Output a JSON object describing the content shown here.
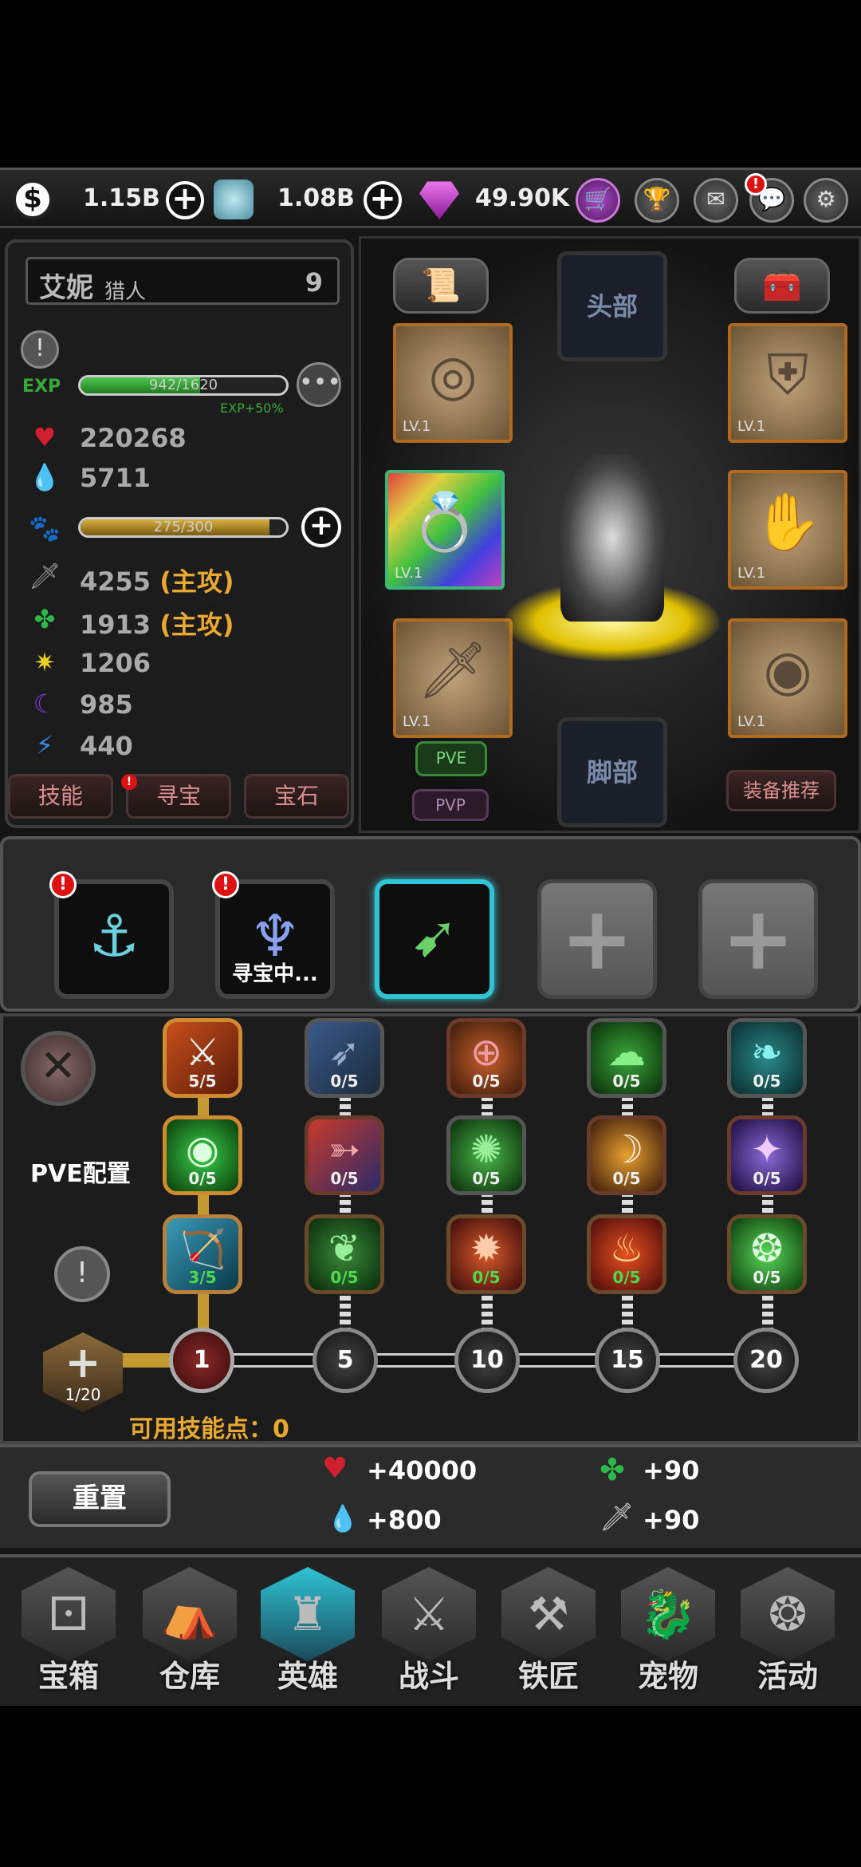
{
  "currency": {
    "gold": "1.15B",
    "crystal": "1.08B",
    "gem": "49.90K"
  },
  "topbar_icons": [
    "dollar-icon",
    "crystal-icon",
    "gem-icon",
    "cart-icon",
    "trophy-icon",
    "mail-icon",
    "chat-icon",
    "gear-icon"
  ],
  "hero": {
    "name": "艾妮",
    "class": "猎人",
    "level": "9",
    "exp_label": "EXP",
    "exp_text": "942/1620",
    "exp_fraction": 0.58,
    "exp_bonus": "EXP+50%",
    "pet_text": "275/300",
    "pet_fraction": 0.92,
    "stats": [
      {
        "icon": "heart-icon",
        "value": "220268",
        "tag": ""
      },
      {
        "icon": "water-drop-icon",
        "value": "5711",
        "tag": ""
      },
      {
        "icon": "sword-icon",
        "value": "4255",
        "tag": "(主攻)"
      },
      {
        "icon": "clover-icon",
        "value": "1913",
        "tag": "(主攻)"
      },
      {
        "icon": "sun-icon",
        "value": "1206",
        "tag": ""
      },
      {
        "icon": "moon-icon",
        "value": "985",
        "tag": ""
      },
      {
        "icon": "lightning-icon",
        "value": "440",
        "tag": ""
      }
    ]
  },
  "left_tabs": [
    "技能",
    "寻宝",
    "宝石"
  ],
  "equipment": {
    "head_label": "头部",
    "feet_label": "脚部",
    "pve": "PVE",
    "pvp": "PVP",
    "recommend": "装备推荐",
    "slots": [
      {
        "name": "necklace",
        "lv": "LV.1"
      },
      {
        "name": "ring",
        "lv": "LV.1"
      },
      {
        "name": "sword",
        "lv": "LV.1"
      },
      {
        "name": "armor",
        "lv": "LV.1"
      },
      {
        "name": "gloves",
        "lv": "LV.1"
      },
      {
        "name": "shield",
        "lv": "LV.1"
      }
    ]
  },
  "skill_slots": {
    "treasure_label": "寻宝中..."
  },
  "tree": {
    "config_label": "PVE配置",
    "points_label": "可用技能点：",
    "points_value": "0",
    "root_count": "1/20",
    "levels": [
      "1",
      "5",
      "10",
      "15",
      "20"
    ],
    "rows": [
      [
        "5/5",
        "0/5",
        "0/5",
        "0/5",
        "0/5"
      ],
      [
        "0/5",
        "0/5",
        "0/5",
        "0/5",
        "0/5"
      ],
      [
        "3/5",
        "0/5",
        "0/5",
        "0/5",
        "0/5"
      ]
    ]
  },
  "bonus": {
    "reset": "重置",
    "hp": "+40000",
    "mp": "+800",
    "clover": "+90",
    "attack": "+90"
  },
  "nav": [
    "宝箱",
    "仓库",
    "英雄",
    "战斗",
    "铁匠",
    "宠物",
    "活动"
  ],
  "colors": {
    "accent": "#2ec4d4",
    "orange": "#e9a830",
    "hp": "#d21f2f",
    "exp": "#38a838"
  }
}
